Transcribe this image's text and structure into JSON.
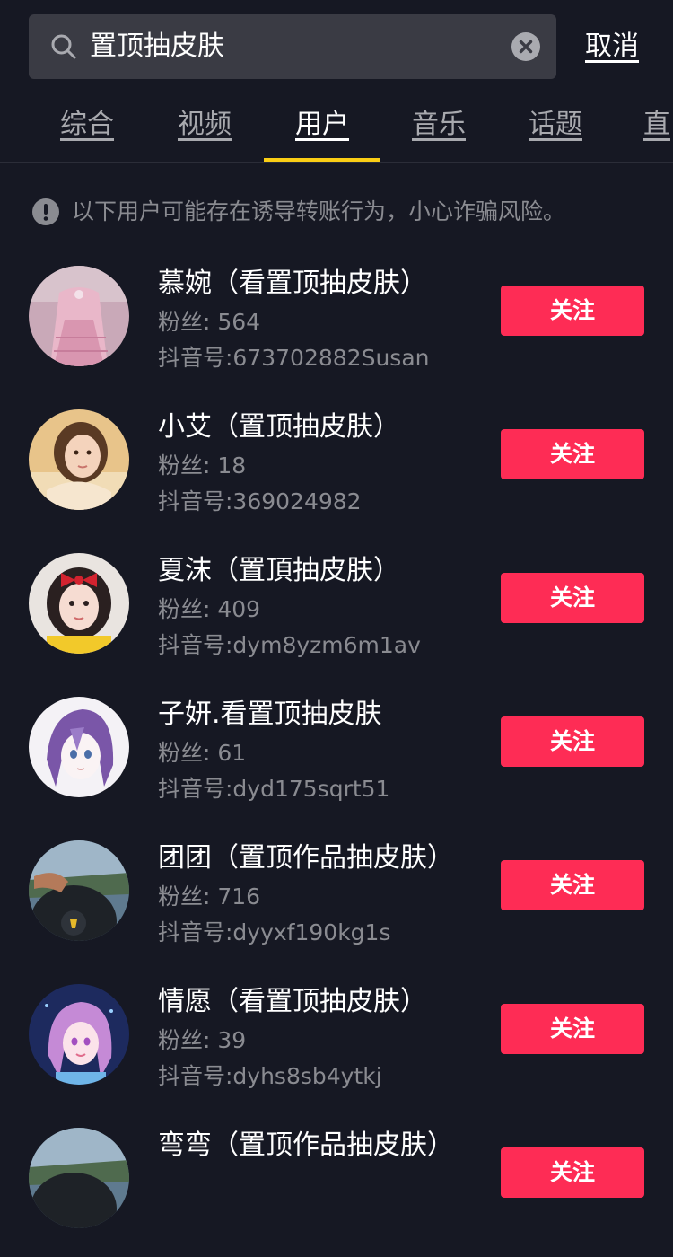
{
  "search": {
    "query": "置顶抽皮肤",
    "search_icon": "search-icon",
    "clear_icon": "close-circle-icon",
    "cancel_label": "取消"
  },
  "tabs": [
    {
      "label": "综合",
      "active": false
    },
    {
      "label": "视频",
      "active": false
    },
    {
      "label": "用户",
      "active": true
    },
    {
      "label": "音乐",
      "active": false
    },
    {
      "label": "话题",
      "active": false
    },
    {
      "label": "直",
      "active": false
    }
  ],
  "colors": {
    "background": "#161823",
    "accent": "#face15",
    "follow_button": "#fe2c55"
  },
  "warning": {
    "icon": "exclamation-circle-icon",
    "text": "以下用户可能存在诱导转账行为，小心诈骗风险。"
  },
  "users": [
    {
      "name": "慕婉（看置顶抽皮肤）",
      "fans": "粉丝: 564",
      "douyin_id": "抖音号:673702882Susan",
      "follow_label": "关注"
    },
    {
      "name": "小艾（置顶抽皮肤）",
      "fans": "粉丝: 18",
      "douyin_id": "抖音号:369024982",
      "follow_label": "关注"
    },
    {
      "name": "夏沫（置頂抽皮肤）",
      "fans": "粉丝: 409",
      "douyin_id": "抖音号:dym8yzm6m1av",
      "follow_label": "关注"
    },
    {
      "name": "子妍.看置顶抽皮肤",
      "fans": "粉丝: 61",
      "douyin_id": "抖音号:dyd175sqrt51",
      "follow_label": "关注"
    },
    {
      "name": "团团（置顶作品抽皮肤）",
      "fans": "粉丝: 716",
      "douyin_id": "抖音号:dyyxf190kg1s",
      "follow_label": "关注"
    },
    {
      "name": "情愿（看置顶抽皮肤）",
      "fans": "粉丝: 39",
      "douyin_id": "抖音号:dyhs8sb4ytkj",
      "follow_label": "关注"
    },
    {
      "name": "弯弯（置顶作品抽皮肤）",
      "fans": "",
      "douyin_id": "",
      "follow_label": "关注"
    }
  ]
}
